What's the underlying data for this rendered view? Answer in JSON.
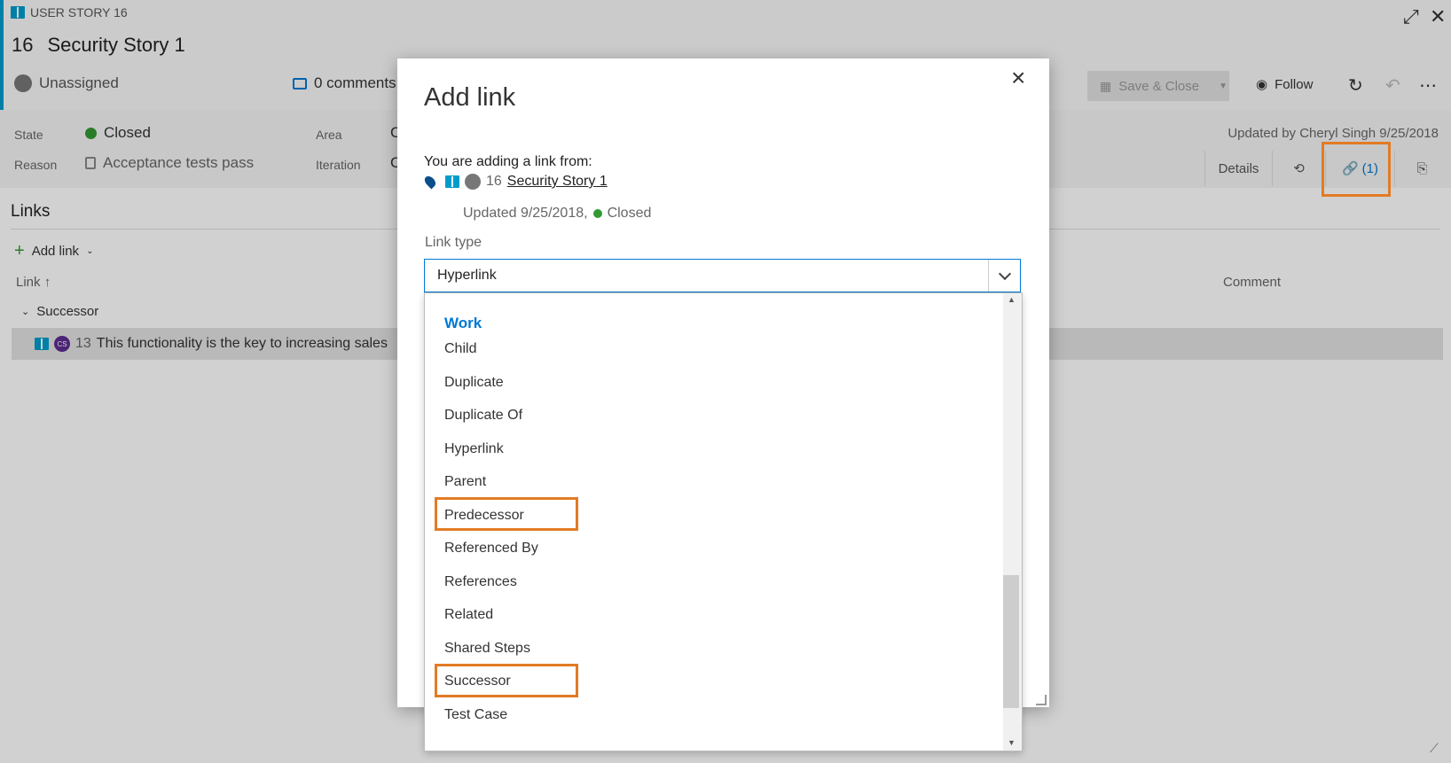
{
  "work_item": {
    "type_label": "USER STORY 16",
    "id": "16",
    "title": "Security Story 1",
    "assignee": "Unassigned",
    "comments": "0 comments",
    "save_close_label": "Save & Close",
    "follow_label": "Follow",
    "updated_by": "Updated by Cheryl Singh 9/25/2018",
    "fields": {
      "state_label": "State",
      "state_value": "Closed",
      "reason_label": "Reason",
      "reason_value": "Acceptance tests pass",
      "area_label": "Area",
      "area_value": "C",
      "iteration_label": "Iteration",
      "iteration_value": "C"
    },
    "tabs": {
      "details": "Details",
      "links": "(1)"
    },
    "links_section": {
      "title": "Links",
      "add_link": "Add link",
      "col_link": "Link",
      "col_comment": "Comment",
      "group": "Successor",
      "row_avatar": "CS",
      "row_id": "13",
      "row_title": "This functionality is the key to increasing sales"
    }
  },
  "modal": {
    "title": "Add link",
    "from_text": "You are adding a link from:",
    "source_id": "16",
    "source_title": "Security Story 1",
    "source_updated": "Updated 9/25/2018,",
    "source_state": "Closed",
    "link_type_label": "Link type",
    "link_type_value": "Hyperlink"
  },
  "dropdown": {
    "group_label": "Work",
    "items": [
      "Child",
      "Duplicate",
      "Duplicate Of",
      "Hyperlink",
      "Parent",
      "Predecessor",
      "Referenced By",
      "References",
      "Related",
      "Shared Steps",
      "Successor",
      "Test Case"
    ],
    "highlighted": [
      "Predecessor",
      "Successor"
    ]
  },
  "colors": {
    "accent": "#0078d4",
    "work_item_blue": "#009ccc",
    "closed_green": "#339933",
    "highlight_orange": "#e27b24"
  },
  "icons": [
    "book-icon",
    "expand-icon",
    "close-icon",
    "comment-icon",
    "save-icon",
    "eye-icon",
    "refresh-icon",
    "undo-icon",
    "more-icon",
    "lock-icon",
    "history-icon",
    "link-icon",
    "attachment-icon",
    "plus-icon",
    "pin-icon",
    "chevron-down-icon"
  ]
}
